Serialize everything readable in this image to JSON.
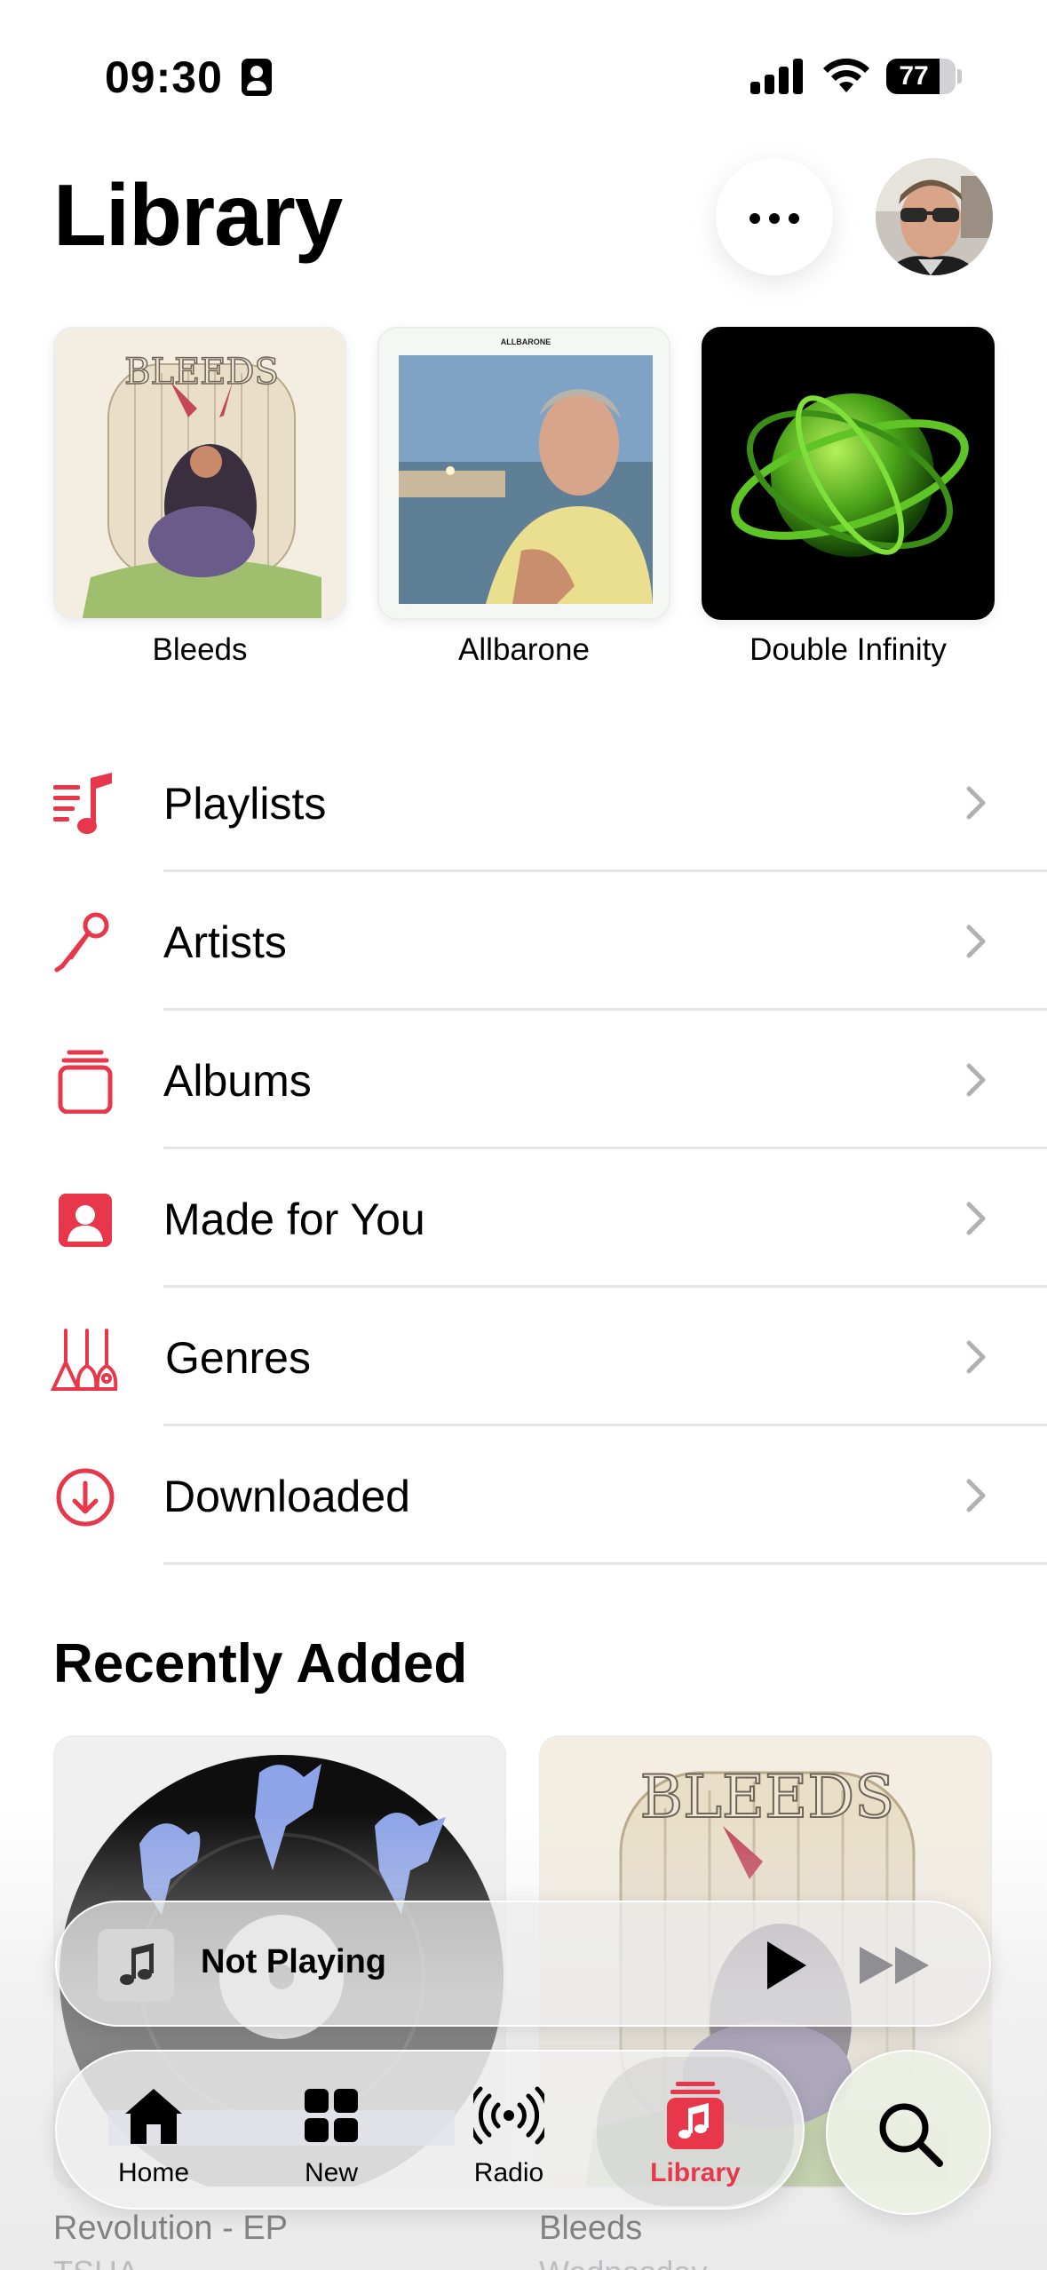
{
  "status_bar": {
    "time": "09:30",
    "battery": "77",
    "battery_level": 0.77
  },
  "header": {
    "title": "Library",
    "more_label": "More"
  },
  "pinned": [
    {
      "label": "Bleeds"
    },
    {
      "label": "Allbarone",
      "cover_text": "ALLBARONE"
    },
    {
      "label": "Double Infinity"
    }
  ],
  "menu": [
    {
      "label": "Playlists",
      "icon": "playlist-icon"
    },
    {
      "label": "Artists",
      "icon": "microphone-icon"
    },
    {
      "label": "Albums",
      "icon": "album-stack-icon"
    },
    {
      "label": "Made for You",
      "icon": "person-square-icon"
    },
    {
      "label": "Genres",
      "icon": "guitars-icon"
    },
    {
      "label": "Downloaded",
      "icon": "download-icon"
    }
  ],
  "recently_added": {
    "title": "Recently Added",
    "items": [
      {
        "title": "Revolution - EP",
        "subtitle": "TSHA"
      },
      {
        "title": "Bleeds",
        "subtitle": "Wednesday"
      }
    ]
  },
  "mini_player": {
    "title": "Not Playing"
  },
  "tabs": [
    {
      "label": "Home",
      "icon": "house-icon"
    },
    {
      "label": "New",
      "icon": "grid-icon"
    },
    {
      "label": "Radio",
      "icon": "radio-waves-icon"
    },
    {
      "label": "Library",
      "icon": "music-note-library-icon",
      "active": true
    }
  ],
  "colors": {
    "accent": "#e8364b",
    "separator": "#e5e5ea",
    "secondary_text": "#8e8e93"
  }
}
